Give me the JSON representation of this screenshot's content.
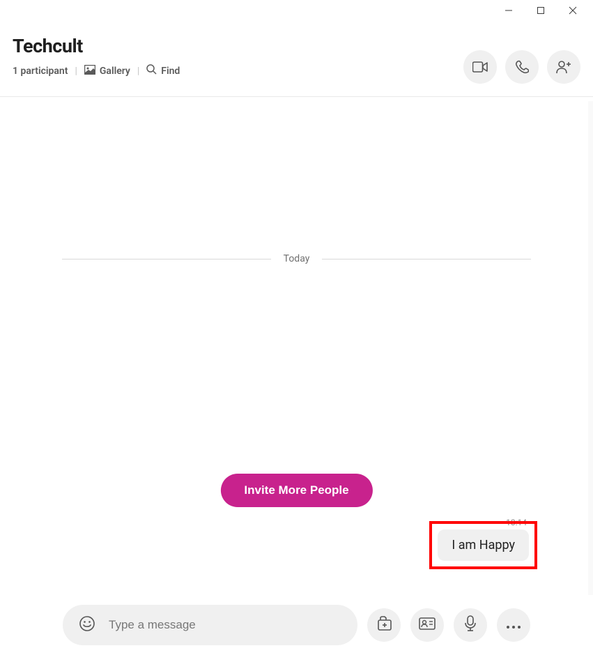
{
  "header": {
    "title": "Techcult",
    "participant_text": "1 participant",
    "gallery_label": "Gallery",
    "find_label": "Find"
  },
  "chat": {
    "date_label": "Today",
    "invite_label": "Invite More People",
    "message_time": "18:14",
    "message_text": "I am Happy"
  },
  "compose": {
    "placeholder": "Type a message"
  },
  "colors": {
    "accent": "#c8228d",
    "highlight": "#ff0000"
  }
}
